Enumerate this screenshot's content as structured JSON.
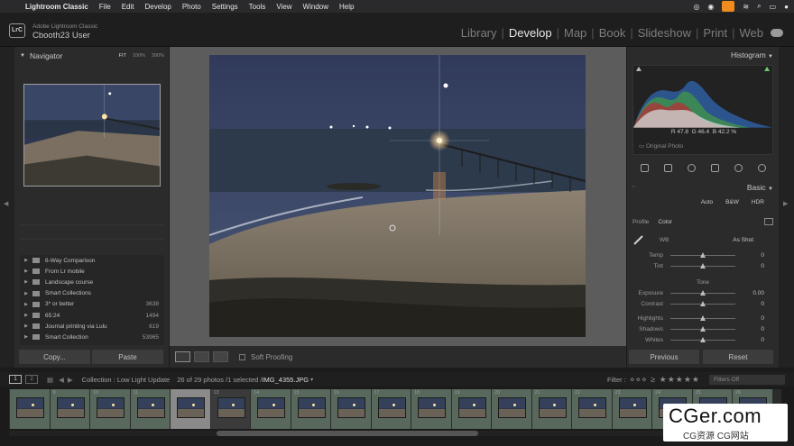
{
  "menubar": {
    "app": "Lightroom Classic",
    "items": [
      "File",
      "Edit",
      "Develop",
      "Photo",
      "Settings",
      "Tools",
      "View",
      "Window",
      "Help"
    ]
  },
  "identity": {
    "logo": "LrC",
    "product": "Adobe Lightroom Classic",
    "user": "Cbooth23 User"
  },
  "modules": [
    "Library",
    "Develop",
    "Map",
    "Book",
    "Slideshow",
    "Print",
    "Web"
  ],
  "active_module": "Develop",
  "navigator": {
    "title": "Navigator",
    "zooms": [
      "FIT",
      "100%",
      "300%"
    ]
  },
  "collections": [
    {
      "name": "6-Way Comparison",
      "count": ""
    },
    {
      "name": "From Lr mobile",
      "count": ""
    },
    {
      "name": "Landscape course",
      "count": ""
    },
    {
      "name": "Smart Collections",
      "count": ""
    },
    {
      "name": "3* or better",
      "count": "3638"
    },
    {
      "name": "65:24",
      "count": "1494"
    },
    {
      "name": "Journal printing via Lulu",
      "count": "619"
    },
    {
      "name": "Smart Collection",
      "count": "53965"
    }
  ],
  "left_buttons": {
    "copy": "Copy...",
    "paste": "Paste"
  },
  "toolbar": {
    "soft_proofing": "Soft Proofing"
  },
  "histogram": {
    "title": "Histogram",
    "r_label": "R",
    "r": "47.8",
    "g_label": "G",
    "g": "46.4",
    "b_label": "B",
    "b": "42.2",
    "pct": "%",
    "original": "Original Photo"
  },
  "basic": {
    "title": "Basic",
    "treatments": [
      "Auto",
      "B&W",
      "HDR"
    ],
    "profile_label": "Profile",
    "profile_value": "Color",
    "wb_label": "WB",
    "wb_value": "As Shot",
    "tone_label": "Tone",
    "sliders_wb": [
      {
        "name": "Temp",
        "value": "0"
      },
      {
        "name": "Tint",
        "value": "0"
      }
    ],
    "sliders_tone": [
      {
        "name": "Exposure",
        "value": "0.00"
      },
      {
        "name": "Contrast",
        "value": "0"
      },
      {
        "name": "Highlights",
        "value": "0"
      },
      {
        "name": "Shadows",
        "value": "0"
      },
      {
        "name": "Whites",
        "value": "0"
      }
    ]
  },
  "right_buttons": {
    "previous": "Previous",
    "reset": "Reset"
  },
  "filmbar": {
    "screen1": "1",
    "screen2": "2",
    "collection": "Collection : Low Light Update",
    "status": "26 of 29 photos /1 selected /",
    "filename": "IMG_4355.JPG",
    "filter_label": "Filter :",
    "filters_off": "Filters Off"
  },
  "filmstrip": [
    {
      "n": "",
      "picked": true,
      "sel": false
    },
    {
      "n": "9",
      "picked": true,
      "sel": false
    },
    {
      "n": "10",
      "picked": true,
      "sel": false
    },
    {
      "n": "11",
      "picked": true,
      "sel": false
    },
    {
      "n": "12",
      "picked": false,
      "sel": true
    },
    {
      "n": "13",
      "picked": false,
      "sel": false
    },
    {
      "n": "14",
      "picked": true,
      "sel": false
    },
    {
      "n": "15",
      "picked": true,
      "sel": false
    },
    {
      "n": "16",
      "picked": true,
      "sel": false
    },
    {
      "n": "17",
      "picked": true,
      "sel": false
    },
    {
      "n": "18",
      "picked": true,
      "sel": false
    },
    {
      "n": "19",
      "picked": true,
      "sel": false
    },
    {
      "n": "20",
      "picked": true,
      "sel": false
    },
    {
      "n": "21",
      "picked": true,
      "sel": false
    },
    {
      "n": "22",
      "picked": true,
      "sel": false
    },
    {
      "n": "23",
      "picked": true,
      "sel": false
    },
    {
      "n": "24",
      "picked": true,
      "sel": false
    },
    {
      "n": "25",
      "picked": true,
      "sel": false
    },
    {
      "n": "26",
      "picked": true,
      "sel": false
    }
  ],
  "watermark": {
    "big": "CGer.com",
    "small": "CG资源 CG网站"
  },
  "colors": {
    "accent_pick": "#58685c",
    "selected": "#8a8a8a",
    "record": "#f08b1d"
  }
}
